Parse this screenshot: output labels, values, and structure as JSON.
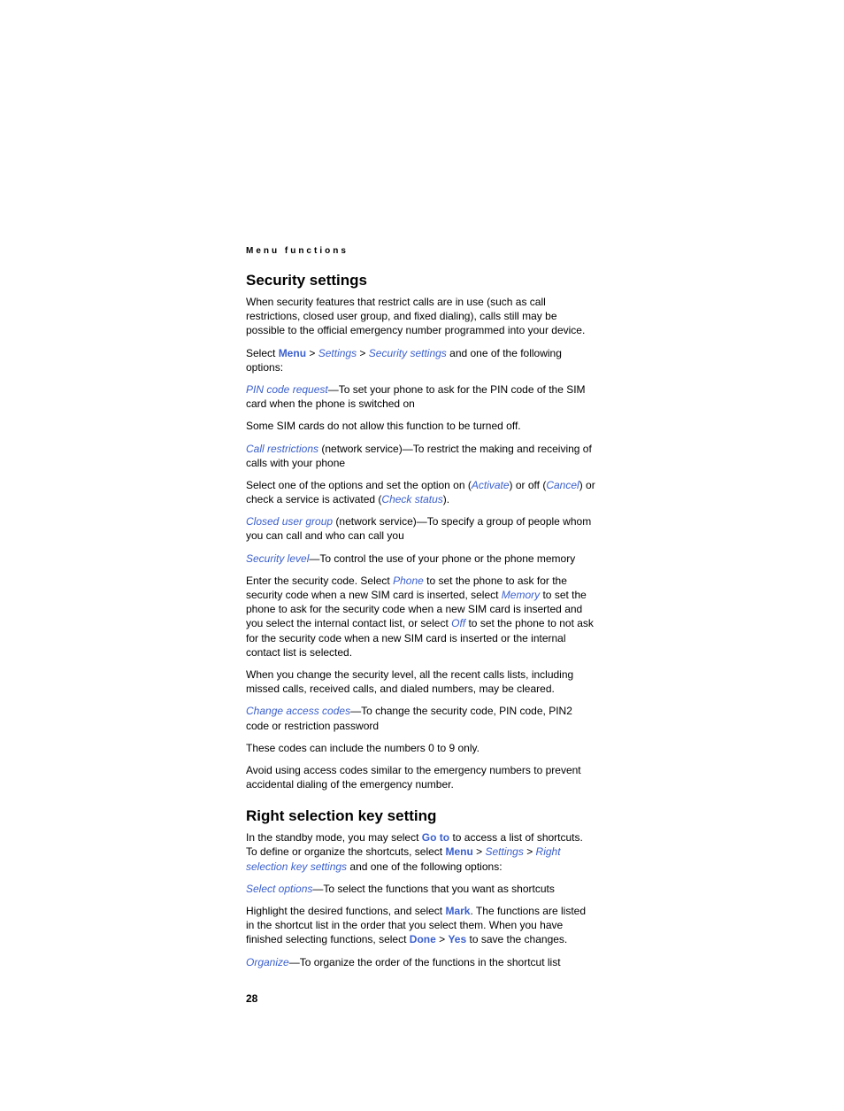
{
  "runningHeader": "Menu functions",
  "section1": {
    "title": "Security settings",
    "p1": "When security features that restrict calls are in use (such as call restrictions, closed user group, and fixed dialing), calls still may be possible to the official emergency number programmed into your device.",
    "p2": {
      "t1": "Select ",
      "menu": "Menu",
      "gt1": " > ",
      "settings": "Settings",
      "gt2": " > ",
      "secset": "Security settings",
      "t2": " and one of the following options:"
    },
    "p3": {
      "pin": "PIN code request",
      "t": "—To set your phone to ask for the PIN code of the SIM card when the phone is switched on"
    },
    "p4": "Some SIM cards do not allow this function to be turned off.",
    "p5": {
      "cr": "Call restrictions",
      "t": " (network service)—To restrict the making and receiving of calls with your phone"
    },
    "p6": {
      "t1": "Select one of the options and set the option on (",
      "activate": "Activate",
      "t2": ") or off (",
      "cancel": "Cancel",
      "t3": ") or check a service is activated (",
      "check": "Check status",
      "t4": ")."
    },
    "p7": {
      "cug": "Closed user group",
      "t": " (network service)—To specify a group of people whom you can call and who can call you"
    },
    "p8": {
      "sl": "Security level",
      "t": "—To control the use of your phone or the phone memory"
    },
    "p9": {
      "t1": "Enter the security code. Select ",
      "phone": "Phone",
      "t2": " to set the phone to ask for the security code when a new SIM card is inserted, select ",
      "memory": "Memory",
      "t3": " to set the phone to ask for the security code when a new SIM card is inserted and you select the internal contact list, or select ",
      "off": "Off",
      "t4": " to set the phone to not ask for the security code when a new SIM card is inserted or the internal contact list is selected."
    },
    "p10": "When you change the security level, all the recent calls lists, including missed calls, received calls, and dialed numbers, may be cleared.",
    "p11": {
      "cac": "Change access codes",
      "t": "—To change the security code, PIN code, PIN2 code or restriction password"
    },
    "p12": "These codes can include the numbers 0 to 9 only.",
    "p13": "Avoid using access codes similar to the emergency numbers to prevent accidental dialing of the emergency number."
  },
  "section2": {
    "title": "Right selection key setting",
    "p1": {
      "t1": "In the standby mode, you may select ",
      "goto": "Go to",
      "t2": " to access a list of shortcuts. To define or organize the shortcuts, select ",
      "menu": "Menu",
      "gt1": " > ",
      "settings": "Settings",
      "gt2": " > ",
      "rsk": "Right selection key settings",
      "t3": " and one of the following options:"
    },
    "p2": {
      "so": "Select options",
      "t": "—To select the functions that you want as shortcuts"
    },
    "p3": {
      "t1": "Highlight the desired functions, and select ",
      "mark": "Mark",
      "t2": ". The functions are listed in the shortcut list in the order that you select them. When you have finished selecting functions, select ",
      "done": "Done",
      "gt": " > ",
      "yes": "Yes",
      "t3": " to save the changes."
    },
    "p4": {
      "org": "Organize",
      "t": "—To organize the order of the functions in the shortcut list"
    }
  },
  "pageNumber": "28"
}
